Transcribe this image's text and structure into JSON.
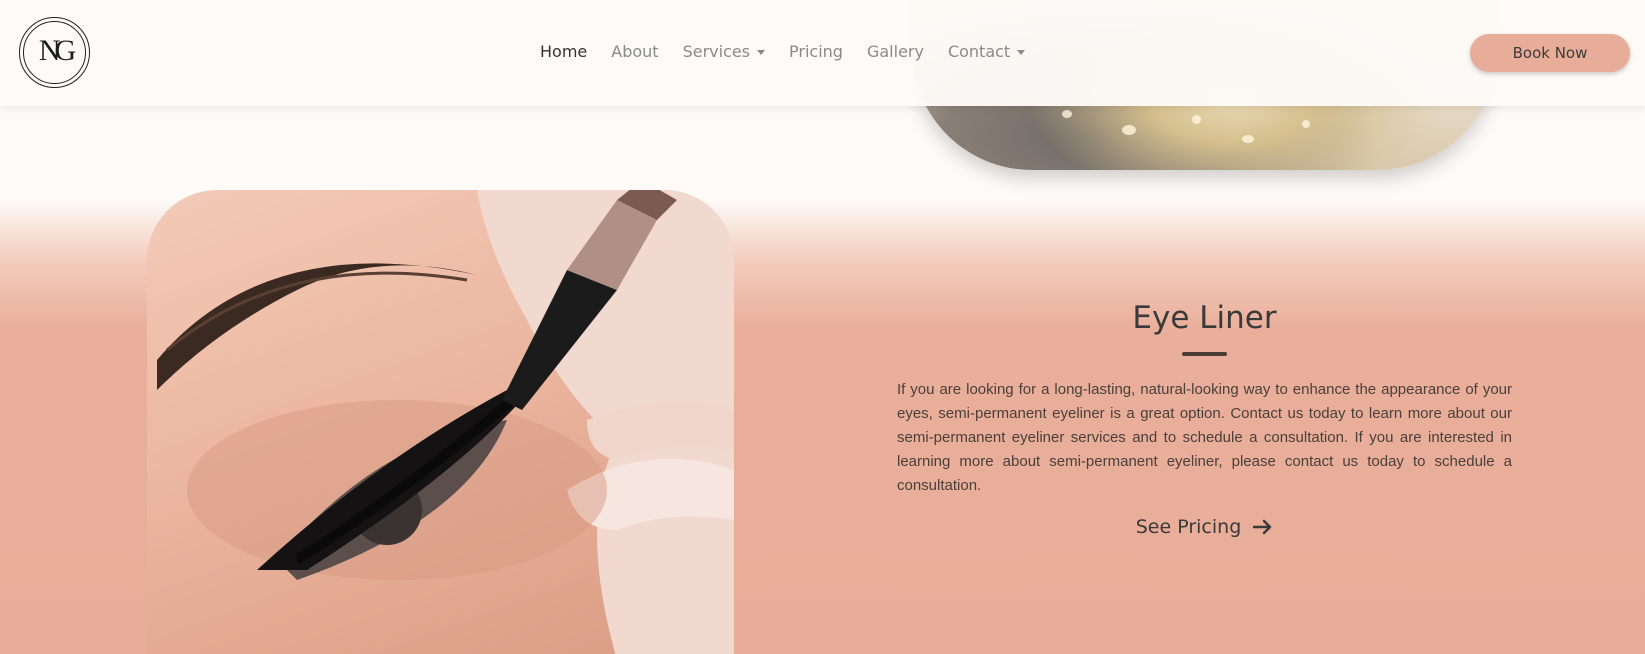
{
  "header": {
    "logo_text": "NG",
    "nav": [
      {
        "label": "Home",
        "active": true,
        "dropdown": false
      },
      {
        "label": "About",
        "active": false,
        "dropdown": false
      },
      {
        "label": "Services",
        "active": false,
        "dropdown": true
      },
      {
        "label": "Pricing",
        "active": false,
        "dropdown": false
      },
      {
        "label": "Gallery",
        "active": false,
        "dropdown": false
      },
      {
        "label": "Contact",
        "active": false,
        "dropdown": true
      }
    ],
    "cta_label": "Book Now"
  },
  "section": {
    "title": "Eye Liner",
    "body": "If you are looking for a long-lasting, natural-looking way to enhance the appearance of your eyes, semi-permanent eyeliner is a great option. Contact us today to learn more about our semi-permanent eyeliner services and to schedule a consultation. If you are interested in learning more about semi-permanent eyeliner, please contact us today to schedule a consultation.",
    "link_label": "See Pricing"
  },
  "colors": {
    "accent": "#e8ad98",
    "background": "#fdfaf7",
    "text": "#3a3a3a"
  },
  "icons": {
    "link_arrow": "arrow-right-icon",
    "dropdown": "caret-down-icon"
  }
}
